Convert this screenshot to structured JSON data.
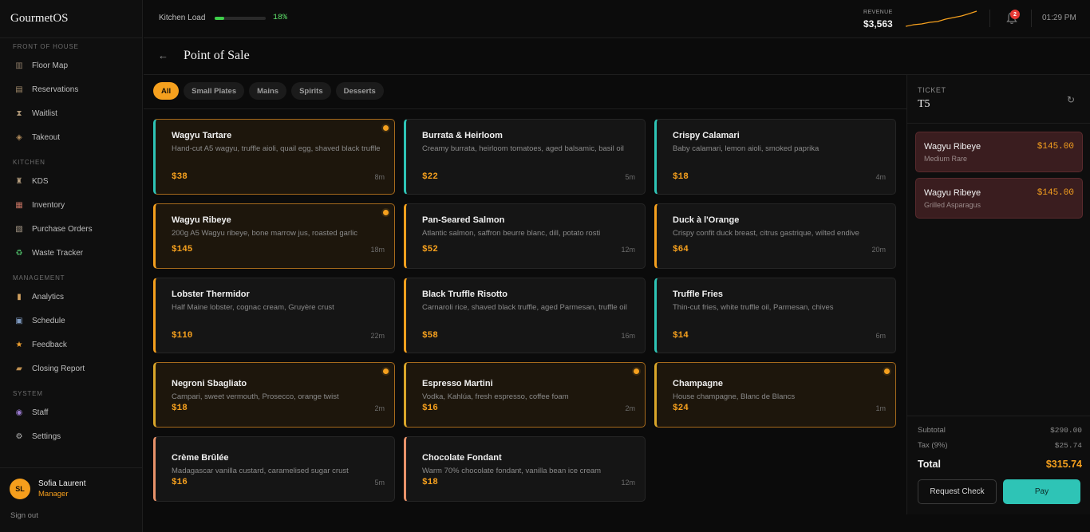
{
  "app": {
    "name": "GourmetOS"
  },
  "sidebar": {
    "sections": [
      {
        "label": "FRONT OF HOUSE",
        "items": [
          {
            "label": "Floor Map",
            "icon": "table-icon"
          },
          {
            "label": "Reservations",
            "icon": "clipboard-icon"
          },
          {
            "label": "Waitlist",
            "icon": "hourglass-icon"
          },
          {
            "label": "Takeout",
            "icon": "package-icon"
          }
        ]
      },
      {
        "label": "KITCHEN",
        "items": [
          {
            "label": "KDS",
            "icon": "chef-icon"
          },
          {
            "label": "Inventory",
            "icon": "shelves-icon"
          },
          {
            "label": "Purchase Orders",
            "icon": "receipt-icon"
          },
          {
            "label": "Waste Tracker",
            "icon": "recycle-icon"
          }
        ]
      },
      {
        "label": "MANAGEMENT",
        "items": [
          {
            "label": "Analytics",
            "icon": "chart-icon"
          },
          {
            "label": "Schedule",
            "icon": "calendar-icon"
          },
          {
            "label": "Feedback",
            "icon": "star-icon"
          },
          {
            "label": "Closing Report",
            "icon": "lock-icon"
          }
        ]
      },
      {
        "label": "SYSTEM",
        "items": [
          {
            "label": "Staff",
            "icon": "people-icon"
          },
          {
            "label": "Settings",
            "icon": "gear-icon"
          }
        ]
      }
    ],
    "user": {
      "initials": "SL",
      "name": "Sofia Laurent",
      "role": "Manager",
      "signout": "Sign out"
    }
  },
  "topbar": {
    "kitchen_load_label": "Kitchen Load",
    "kitchen_load_value": "18%",
    "kitchen_load_fraction": 0.18,
    "revenue_label": "REVENUE",
    "revenue_value": "$3,563",
    "notification_count": "2",
    "clock": "01:29 PM"
  },
  "header": {
    "title": "Point of Sale"
  },
  "filters": [
    "All",
    "Small Plates",
    "Mains",
    "Spirits",
    "Desserts"
  ],
  "active_filter": "All",
  "menu": [
    {
      "name": "Wagyu Tartare",
      "desc": "Hand-cut A5 wagyu, truffle aioli, quail egg, shaved black truffle",
      "price": "$38",
      "time": "8m",
      "accent": "#2ec4b6",
      "selected": true
    },
    {
      "name": "Burrata & Heirloom",
      "desc": "Creamy burrata, heirloom tomatoes, aged balsamic, basil oil",
      "price": "$22",
      "time": "5m",
      "accent": "#2ec4b6",
      "selected": false
    },
    {
      "name": "Crispy Calamari",
      "desc": "Baby calamari, lemon aioli, smoked paprika",
      "price": "$18",
      "time": "4m",
      "accent": "#2ec4b6",
      "selected": false
    },
    {
      "name": "Wagyu Ribeye",
      "desc": "200g A5 Wagyu ribeye, bone marrow jus, roasted garlic",
      "price": "$145",
      "time": "18m",
      "accent": "#f5a01e",
      "selected": true
    },
    {
      "name": "Pan-Seared Salmon",
      "desc": "Atlantic salmon, saffron beurre blanc, dill, potato rosti",
      "price": "$52",
      "time": "12m",
      "accent": "#f5a01e",
      "selected": false
    },
    {
      "name": "Duck à l'Orange",
      "desc": "Crispy confit duck breast, citrus gastrique, wilted endive",
      "price": "$64",
      "time": "20m",
      "accent": "#f5a01e",
      "selected": false
    },
    {
      "name": "Lobster Thermidor",
      "desc": "Half Maine lobster, cognac cream, Gruyère crust",
      "price": "$110",
      "time": "22m",
      "accent": "#f5a01e",
      "selected": false
    },
    {
      "name": "Black Truffle Risotto",
      "desc": "Carnaroli rice, shaved black truffle, aged Parmesan, truffle oil",
      "price": "$58",
      "time": "16m",
      "accent": "#f5a01e",
      "selected": false
    },
    {
      "name": "Truffle Fries",
      "desc": "Thin-cut fries, white truffle oil, Parmesan, chives",
      "price": "$14",
      "time": "6m",
      "accent": "#2ec4b6",
      "selected": false
    },
    {
      "name": "Negroni Sbagliato",
      "desc": "Campari, sweet vermouth, Prosecco, orange twist",
      "price": "$18",
      "time": "2m",
      "accent": "#d9a62a",
      "selected": true
    },
    {
      "name": "Espresso Martini",
      "desc": "Vodka, Kahlúa, fresh espresso, coffee foam",
      "price": "$16",
      "time": "2m",
      "accent": "#d9a62a",
      "selected": true
    },
    {
      "name": "Champagne",
      "desc": "House champagne, Blanc de Blancs",
      "price": "$24",
      "time": "1m",
      "accent": "#d9a62a",
      "selected": true
    },
    {
      "name": "Crème Brûlée",
      "desc": "Madagascar vanilla custard, caramelised sugar crust",
      "price": "$16",
      "time": "5m",
      "accent": "#e8926a",
      "selected": false
    },
    {
      "name": "Chocolate Fondant",
      "desc": "Warm 70% chocolate fondant, vanilla bean ice cream",
      "price": "$18",
      "time": "12m",
      "accent": "#e8926a",
      "selected": false
    }
  ],
  "ticket": {
    "label": "TICKET",
    "id": "T5",
    "items": [
      {
        "name": "Wagyu Ribeye",
        "modifier": "Medium Rare",
        "price": "$145.00"
      },
      {
        "name": "Wagyu Ribeye",
        "modifier": "Grilled Asparagus",
        "price": "$145.00"
      }
    ],
    "subtotal_label": "Subtotal",
    "subtotal": "$290.00",
    "tax_label": "Tax (9%)",
    "tax": "$25.74",
    "total_label": "Total",
    "total": "$315.74",
    "request_check": "Request Check",
    "pay": "Pay"
  },
  "colors": {
    "accent": "#f5a01e",
    "teal": "#2ec4b6",
    "success": "#3ecf4a",
    "danger": "#e53935"
  }
}
